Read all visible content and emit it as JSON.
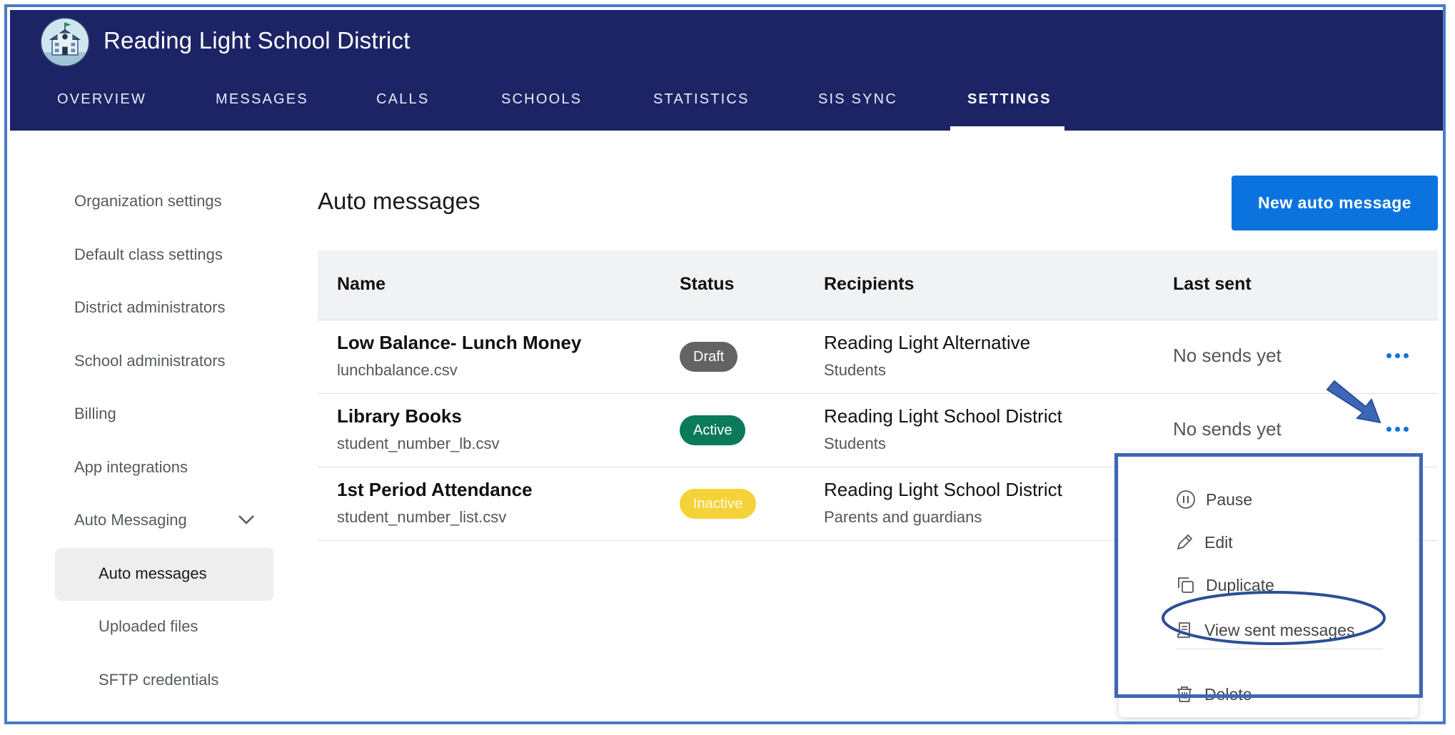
{
  "app": {
    "title": "Reading Light School District"
  },
  "nav": {
    "tabs": [
      {
        "label": "OVERVIEW"
      },
      {
        "label": "MESSAGES"
      },
      {
        "label": "CALLS"
      },
      {
        "label": "SCHOOLS"
      },
      {
        "label": "STATISTICS"
      },
      {
        "label": "SIS SYNC"
      },
      {
        "label": "SETTINGS",
        "active": true
      }
    ]
  },
  "sidebar": {
    "items": [
      {
        "label": "Organization settings"
      },
      {
        "label": "Default class settings"
      },
      {
        "label": "District administrators"
      },
      {
        "label": "School administrators"
      },
      {
        "label": "Billing"
      },
      {
        "label": "App integrations"
      },
      {
        "label": "Auto Messaging",
        "expanded": true
      }
    ],
    "subitems": [
      {
        "label": "Auto messages",
        "active": true
      },
      {
        "label": "Uploaded files"
      },
      {
        "label": "SFTP credentials"
      }
    ]
  },
  "main": {
    "title": "Auto messages",
    "new_button": "New auto message",
    "columns": [
      "Name",
      "Status",
      "Recipients",
      "Last sent"
    ],
    "rows": [
      {
        "name": "Low Balance- Lunch Money",
        "file": "lunchbalance.csv",
        "status": "Draft",
        "recipient": "Reading Light Alternative",
        "recipient_type": "Students",
        "last_sent": "No sends yet"
      },
      {
        "name": "Library Books",
        "file": "student_number_lb.csv",
        "status": "Active",
        "recipient": "Reading Light School District",
        "recipient_type": "Students",
        "last_sent": "No sends yet"
      },
      {
        "name": "1st Period Attendance",
        "file": "student_number_list.csv",
        "status": "Inactive",
        "recipient": "Reading Light School District",
        "recipient_type": "Parents and guardians",
        "last_sent": ""
      }
    ]
  },
  "menu": {
    "items": [
      {
        "label": "Pause",
        "icon": "pause-circle-icon"
      },
      {
        "label": "Edit",
        "icon": "pencil-icon"
      },
      {
        "label": "Duplicate",
        "icon": "duplicate-icon"
      },
      {
        "label": "View sent messages",
        "icon": "receipt-icon"
      },
      {
        "label": "Delete",
        "icon": "trash-icon"
      }
    ]
  },
  "colors": {
    "header_bg": "#1c2465",
    "primary": "#0b73dd",
    "draft": "#636363",
    "active": "#0b7a5a",
    "inactive": "#f5d23a",
    "annotation": "#3d67b6"
  }
}
